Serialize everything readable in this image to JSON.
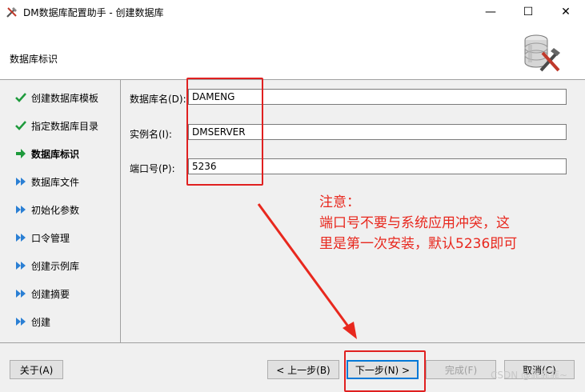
{
  "window": {
    "title": "DM数据库配置助手 - 创建数据库",
    "minimize": "—",
    "maximize": "☐",
    "close": "✕"
  },
  "header": {
    "title": "数据库标识"
  },
  "steps": [
    {
      "label": "创建数据库模板",
      "state": "done"
    },
    {
      "label": "指定数据库目录",
      "state": "done"
    },
    {
      "label": "数据库标识",
      "state": "current"
    },
    {
      "label": "数据库文件",
      "state": "pending"
    },
    {
      "label": "初始化参数",
      "state": "pending"
    },
    {
      "label": "口令管理",
      "state": "pending"
    },
    {
      "label": "创建示例库",
      "state": "pending"
    },
    {
      "label": "创建摘要",
      "state": "pending"
    },
    {
      "label": "创建",
      "state": "pending"
    }
  ],
  "form": {
    "db_name_label": "数据库名(D):",
    "db_name_value": "DAMENG",
    "instance_label": "实例名(I):",
    "instance_value": "DMSERVER",
    "port_label": "端口号(P):",
    "port_value": "5236"
  },
  "annotation": {
    "line1": "注意：",
    "line2": "端口号不要与系统应用冲突，这",
    "line3": "里是第一次安装，默认5236即可",
    "color": "#e8281e"
  },
  "buttons": {
    "about": "关于(A)",
    "back": "< 上一步(B)",
    "next": "下一步(N) >",
    "finish": "完成(F)",
    "cancel": "取消(C)"
  },
  "watermark": "CSDN @菲菲菲~"
}
